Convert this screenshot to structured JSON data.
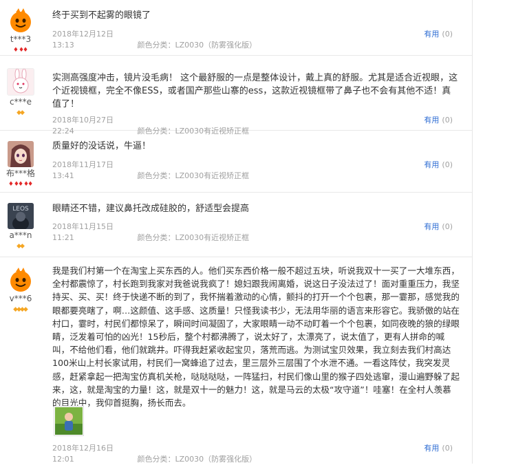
{
  "reviews": [
    {
      "nick": "t***3",
      "level": "red",
      "level_count": 3,
      "avatar": "orange-mascot",
      "text": "终于买到不起雾的眼镜了",
      "date": "2018年12月12日 13:13",
      "spec_label": "颜色分类：",
      "spec_value": "LZ0030（防雾强化版）",
      "useful_label": "有用",
      "useful_count": "(0)"
    },
    {
      "nick": "c***e",
      "level": "gold",
      "level_count": 2,
      "avatar": "bunny",
      "text": "实测高强度冲击，镜片没毛病！ 这个最舒服的一点是整体设计，戴上真的舒服。尤其是适合近视眼，这个近视镜框，完全不像ESS，或者国产那些山寨的ess，这款近视镜框带了鼻子也不会有其他不适！真值了！",
      "date": "2018年10月27日 22:24",
      "spec_label": "颜色分类：",
      "spec_value": "LZ0030有近视矫正框",
      "useful_label": "有用",
      "useful_count": "(0)"
    },
    {
      "nick": "布***格",
      "level": "red",
      "level_count": 5,
      "avatar": "anime-girl",
      "text": "质量好的没话说，牛逼！",
      "date": "2018年11月17日 13:41",
      "spec_label": "颜色分类：",
      "spec_value": "LZ0030有近视矫正框",
      "useful_label": "有用",
      "useful_count": "(0)"
    },
    {
      "nick": "a***n",
      "level": "gold",
      "level_count": 2,
      "avatar": "dark-photo",
      "avatar_text": "LEOS",
      "text": "眼睛还不错，建议鼻托改成硅胶的，舒适型会提高",
      "date": "2018年11月15日 11:21",
      "spec_label": "颜色分类：",
      "spec_value": "LZ0030有近视矫正框",
      "useful_label": "有用",
      "useful_count": "(0)"
    },
    {
      "nick": "v***6",
      "level": "gold",
      "level_count": 4,
      "avatar": "orange-mascot",
      "text": "我是我们村第一个在淘宝上买东西的人。他们买东西价格一般不超过五块，听说我双十一买了一大堆东西，全村都震惊了，村长跑到我家对我爸说我疯了！媳妇跟我闹离婚，说这日子没法过了！面对重重压力，我坚持买、买、买！终于快递不断的到了，我怀揣着激动的心情，颤抖的打开一个个包裹，那一霎那，感觉我的眼都要亮瞎了，啊…这颜值、这手感、这质量！只怪我读书少，无法用华丽的语言来形容它。我骄傲的站在村口，霎时，村民们都惊呆了，瞬间时间凝固了，大家眼睛一动不动盯着一个个包裹，如同夜晚的狼的绿眼睛，泛发着可怕的凶光！15秒后，整个村都沸腾了，说太好了，太漂亮了，说太值了，更有人拼命的喊叫，不给他们看，他们就跳井。吓得我赶紧收起宝贝，落荒而逃。为测试宝贝效果，我立刻去我们村高达100米山上村长家试用，村民们一窝蜂追了过去，里三层外三层围了个水泄不通。一看这阵仗，我突发灵感，赶紧拿起一把淘宝仿真机关枪，哒哒哒哒，一阵猛扫，村民们像山里的猴子四处逃窜，漫山遍野躲了起来，这，就是淘宝的力量！这，就是双十一的魅力！这，就是马云的太极“攻守道”！哇塞！在全村人羡慕的目光中，我仰首挺胸，扬长而去。",
      "date": "2018年12月16日 12:01",
      "spec_label": "颜色分类：",
      "spec_value": "LZ0030（防雾强化版）",
      "useful_label": "有用",
      "useful_count": "(0)",
      "has_photo": true
    }
  ]
}
